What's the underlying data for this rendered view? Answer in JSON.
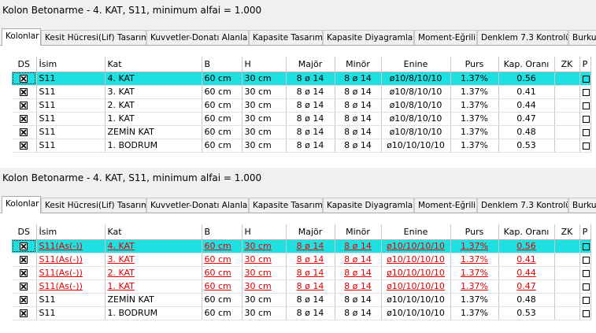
{
  "panels": [
    {
      "title": "Kolon Betonarme - 4. KAT, S11, minimum alfai = 1.000",
      "tabs": [
        "Kolonlar",
        "Kesit Hücresi(Lif) Tasarımı",
        "Kuvvetler-Donatı Alanları",
        "Kapasite Tasarımı",
        "Kapasite Diyagramları",
        "Moment-Eğrilik",
        "Denklem 7.3 Kontrolü",
        "Burkulm"
      ],
      "headers": [
        "DS",
        "İsim",
        "Kat",
        "B",
        "H",
        "Majör",
        "Minör",
        "Enine",
        "Purs",
        "Kap. Oranı",
        "ZK",
        "P"
      ],
      "rows": [
        {
          "isim": "S11",
          "kat": "4. KAT",
          "b": "60 cm",
          "h": "30 cm",
          "major": "8 ø 14",
          "minor": "8 ø 14",
          "enine": "ø10/8/10/10",
          "purs": "1.37%",
          "kap": "0.56"
        },
        {
          "isim": "S11",
          "kat": "3. KAT",
          "b": "60 cm",
          "h": "30 cm",
          "major": "8 ø 14",
          "minor": "8 ø 14",
          "enine": "ø10/8/10/10",
          "purs": "1.37%",
          "kap": "0.41"
        },
        {
          "isim": "S11",
          "kat": "2. KAT",
          "b": "60 cm",
          "h": "30 cm",
          "major": "8 ø 14",
          "minor": "8 ø 14",
          "enine": "ø10/8/10/10",
          "purs": "1.37%",
          "kap": "0.44"
        },
        {
          "isim": "S11",
          "kat": "1. KAT",
          "b": "60 cm",
          "h": "30 cm",
          "major": "8 ø 14",
          "minor": "8 ø 14",
          "enine": "ø10/8/10/10",
          "purs": "1.37%",
          "kap": "0.47"
        },
        {
          "isim": "S11",
          "kat": "ZEMİN KAT",
          "b": "60 cm",
          "h": "30 cm",
          "major": "8 ø 14",
          "minor": "8 ø 14",
          "enine": "ø10/8/10/10",
          "purs": "1.37%",
          "kap": "0.48"
        },
        {
          "isim": "S11",
          "kat": "1. BODRUM",
          "b": "60 cm",
          "h": "30 cm",
          "major": "8 ø 14",
          "minor": "8 ø 14",
          "enine": "ø10/10/10/10",
          "purs": "1.37%",
          "kap": "0.53"
        }
      ]
    },
    {
      "title": "Kolon Betonarme - 4. KAT, S11, minimum alfai = 1.000",
      "tabs": [
        "Kolonlar",
        "Kesit Hücresi(Lif) Tasarımı",
        "Kuvvetler-Donatı Alanları",
        "Kapasite Tasarımı",
        "Kapasite Diyagramları",
        "Moment-Eğrilik",
        "Denklem 7.3 Kontrolü",
        "Burkulm"
      ],
      "headers": [
        "DS",
        "İsim",
        "Kat",
        "B",
        "H",
        "Majör",
        "Minör",
        "Enine",
        "Purs",
        "Kap. Oranı",
        "ZK",
        "P"
      ],
      "rows": [
        {
          "isim": "S11(As(-))",
          "kat": "4. KAT",
          "b": "60 cm",
          "h": "30 cm",
          "major": "8 ø 14",
          "minor": "8 ø 14",
          "enine": "ø10/10/10/10",
          "purs": "1.37%",
          "kap": "0.56"
        },
        {
          "isim": "S11(As(-))",
          "kat": "3. KAT",
          "b": "60 cm",
          "h": "30 cm",
          "major": "8 ø 14",
          "minor": "8 ø 14",
          "enine": "ø10/10/10/10",
          "purs": "1.37%",
          "kap": "0.41"
        },
        {
          "isim": "S11(As(-))",
          "kat": "2. KAT",
          "b": "60 cm",
          "h": "30 cm",
          "major": "8 ø 14",
          "minor": "8 ø 14",
          "enine": "ø10/10/10/10",
          "purs": "1.37%",
          "kap": "0.44"
        },
        {
          "isim": "S11(As(-))",
          "kat": "1. KAT",
          "b": "60 cm",
          "h": "30 cm",
          "major": "8 ø 14",
          "minor": "8 ø 14",
          "enine": "ø10/10/10/10",
          "purs": "1.37%",
          "kap": "0.47"
        },
        {
          "isim": "S11",
          "kat": "ZEMİN KAT",
          "b": "60 cm",
          "h": "30 cm",
          "major": "8 ø 14",
          "minor": "8 ø 14",
          "enine": "ø10/10/10/10",
          "purs": "1.37%",
          "kap": "0.48"
        },
        {
          "isim": "S11",
          "kat": "1. BODRUM",
          "b": "60 cm",
          "h": "30 cm",
          "major": "8 ø 14",
          "minor": "8 ø 14",
          "enine": "ø10/10/10/10",
          "purs": "1.37%",
          "kap": "0.53"
        }
      ]
    }
  ],
  "colors": {
    "selected_row": "#1fe0e0",
    "modified_text": "#e00000",
    "panel_bg": "#f0f0f0"
  },
  "icons": {
    "ds_cell": "checked-box-icon",
    "p_cell": "unchecked-box-icon"
  }
}
